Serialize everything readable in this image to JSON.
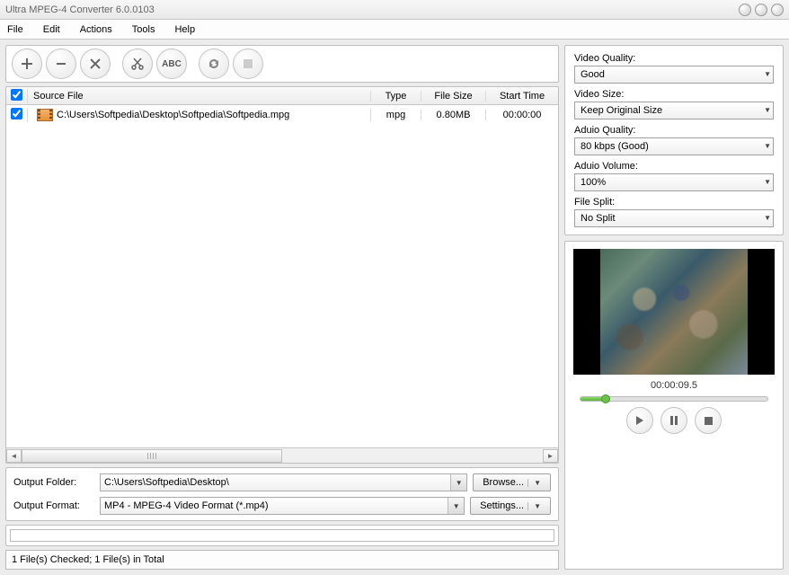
{
  "window": {
    "title": "Ultra MPEG-4 Converter 6.0.0103"
  },
  "menu": {
    "file": "File",
    "edit": "Edit",
    "actions": "Actions",
    "tools": "Tools",
    "help": "Help"
  },
  "toolbar": {
    "add": "+",
    "remove": "−",
    "clear": "✕",
    "cut": "✂",
    "abc": "ABC",
    "convert": "⟳",
    "stop": "■"
  },
  "list": {
    "headers": {
      "source": "Source File",
      "type": "Type",
      "size": "File Size",
      "start": "Start Time"
    },
    "rows": [
      {
        "checked": true,
        "path": "C:\\Users\\Softpedia\\Desktop\\Softpedia\\Softpedia.mpg",
        "type": "mpg",
        "size": "0.80MB",
        "start": "00:00:00"
      }
    ]
  },
  "output": {
    "folder_label": "Output Folder:",
    "folder_value": "C:\\Users\\Softpedia\\Desktop\\",
    "format_label": "Output Format:",
    "format_value": "MP4 - MPEG-4 Video Format (*.mp4)",
    "browse": "Browse...",
    "settings": "Settings..."
  },
  "status": "1 File(s) Checked; 1 File(s) in Total",
  "settings": {
    "video_quality": {
      "label": "Video Quality:",
      "value": "Good"
    },
    "video_size": {
      "label": "Video Size:",
      "value": "Keep Original Size"
    },
    "audio_quality": {
      "label": "Aduio Quality:",
      "value": "80  kbps (Good)"
    },
    "audio_volume": {
      "label": "Aduio Volume:",
      "value": "100%"
    },
    "file_split": {
      "label": "File Split:",
      "value": "No Split"
    }
  },
  "preview": {
    "timecode": "00:00:09.5"
  }
}
